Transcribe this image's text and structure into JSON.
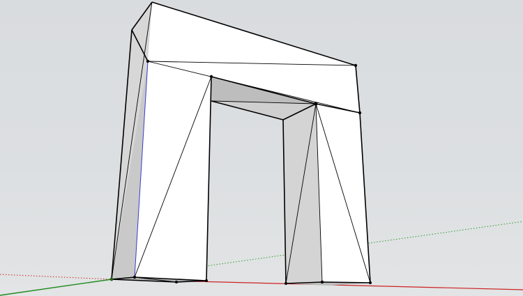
{
  "viewport": {
    "background": "#dcdfe1"
  },
  "colors": {
    "face_lit": "#ffffff",
    "face_side": "#d9d9d9",
    "face_shadow": "#c4c4c4",
    "face_underside": "#b5b5b5",
    "edge": "#000000",
    "axis_red": "#cc2222",
    "axis_green": "#2a9a2a",
    "axis_blue": "#3333cc"
  },
  "model": {
    "type": "arch",
    "name": ""
  },
  "axes": {
    "red": "red-axis",
    "green": "green-axis",
    "blue": "blue-axis"
  }
}
